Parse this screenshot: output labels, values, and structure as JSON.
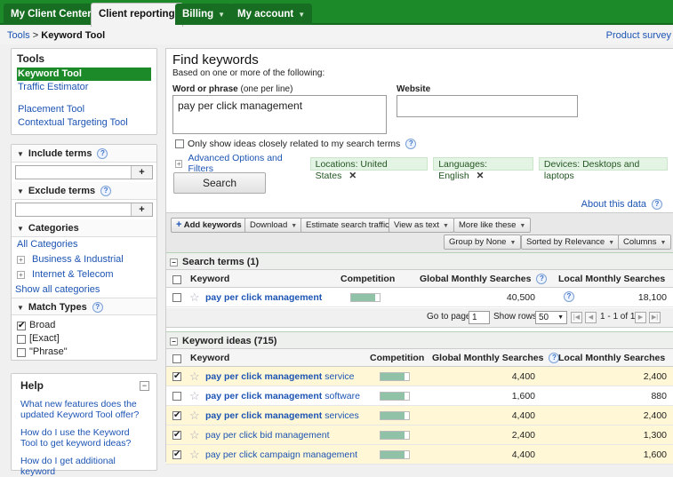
{
  "topnav": {
    "tabs": [
      {
        "label": "My Client Center"
      },
      {
        "label": "Client reporting"
      },
      {
        "label": "Billing"
      },
      {
        "label": "My account"
      }
    ]
  },
  "breadcrumb": {
    "parent": "Tools",
    "separator": ">",
    "current": "Keyword Tool"
  },
  "product_survey": "Product survey",
  "tools_panel": {
    "title": "Tools",
    "items": [
      "Keyword Tool",
      "Traffic Estimator",
      "Placement Tool",
      "Contextual Targeting Tool"
    ]
  },
  "filters": {
    "include_terms": "Include terms",
    "exclude_terms": "Exclude terms",
    "add_symbol": "+",
    "categories": "Categories",
    "category_items": [
      "All Categories",
      "Business & Industrial",
      "Internet & Telecom",
      "Show all categories"
    ],
    "match_types": "Match Types",
    "match_items": [
      {
        "label": "Broad",
        "checked": true
      },
      {
        "label": "[Exact]",
        "checked": false
      },
      {
        "label": "\"Phrase\"",
        "checked": false
      }
    ]
  },
  "help": {
    "title": "Help",
    "links": [
      "What new features does the updated Keyword Tool offer?",
      "How do I use the Keyword Tool to get keyword ideas?",
      "How do I get additional keyword"
    ]
  },
  "find": {
    "title": "Find keywords",
    "subtitle": "Based on one or more of the following:",
    "word_label": "Word or phrase",
    "word_hint": "(one per line)",
    "word_value": "pay per click management",
    "website_label": "Website",
    "website_value": "",
    "only_related": "Only show ideas closely related to my search terms",
    "advanced": "Advanced Options and Filters",
    "chips": [
      "Locations: United States",
      "Languages: English",
      "Devices: Desktops and laptops"
    ],
    "search_button": "Search",
    "about": "About this data"
  },
  "toolbar": {
    "add_keywords": "Add keywords",
    "download": "Download",
    "estimate": "Estimate search traffic",
    "view_as": "View as text",
    "more_like": "More like these",
    "group_by": "Group by None",
    "sorted_by": "Sorted by Relevance",
    "columns": "Columns"
  },
  "search_terms": {
    "title": "Search terms (1)",
    "headers": {
      "keyword": "Keyword",
      "competition": "Competition",
      "global": "Global Monthly Searches",
      "local": "Local Monthly Searches"
    },
    "rows": [
      {
        "keyword": "pay per click management",
        "competition": 0.85,
        "global": "40,500",
        "local": "18,100",
        "checked": false
      }
    ]
  },
  "pager": {
    "goto": "Go to page:",
    "page": "1",
    "show_rows": "Show rows:",
    "rows": "50",
    "range": "1 - 1 of 1"
  },
  "keyword_ideas": {
    "title": "Keyword ideas (715)",
    "headers": {
      "keyword": "Keyword",
      "competition": "Competition",
      "global": "Global Monthly Searches",
      "local": "Local Monthly Searches"
    },
    "rows": [
      {
        "bold": "pay per click management",
        "rest": " service",
        "competition": 0.85,
        "global": "4,400",
        "local": "2,400",
        "checked": true
      },
      {
        "bold": "pay per click management",
        "rest": " software",
        "competition": 0.85,
        "global": "1,600",
        "local": "880",
        "checked": false
      },
      {
        "bold": "pay per click management",
        "rest": " services",
        "competition": 0.85,
        "global": "4,400",
        "local": "2,400",
        "checked": true
      },
      {
        "bold": "",
        "rest": "pay per click bid management",
        "competition": 0.85,
        "global": "2,400",
        "local": "1,300",
        "checked": true
      },
      {
        "bold": "",
        "rest": "pay per click campaign management",
        "competition": 0.85,
        "global": "4,400",
        "local": "1,600",
        "checked": true
      }
    ]
  },
  "colors": {
    "nav_green": "#1d8a2a",
    "link_blue": "#1c54b3",
    "selected_row": "#fff7d6",
    "competition_fill": "#8fc2a6"
  }
}
